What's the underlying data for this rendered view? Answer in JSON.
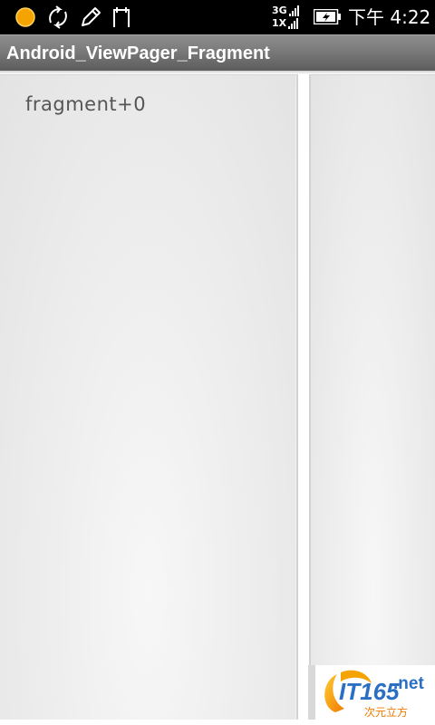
{
  "status_bar": {
    "network_top": "3G",
    "network_bottom": "1X",
    "time": "下午 4:22",
    "icons": [
      "notification-dot-icon",
      "sync-icon",
      "edit-icon",
      "bag-icon",
      "signal-icon",
      "battery-charging-icon"
    ],
    "colors": {
      "background": "#000000",
      "notification": "#f5a300"
    }
  },
  "title_bar": {
    "app_title": "Android_ViewPager_Fragment"
  },
  "pager": {
    "current_page_label": "fragment+0"
  },
  "watermark": {
    "brand": "IT165",
    "domain": ".net",
    "tagline": "次元立方"
  }
}
